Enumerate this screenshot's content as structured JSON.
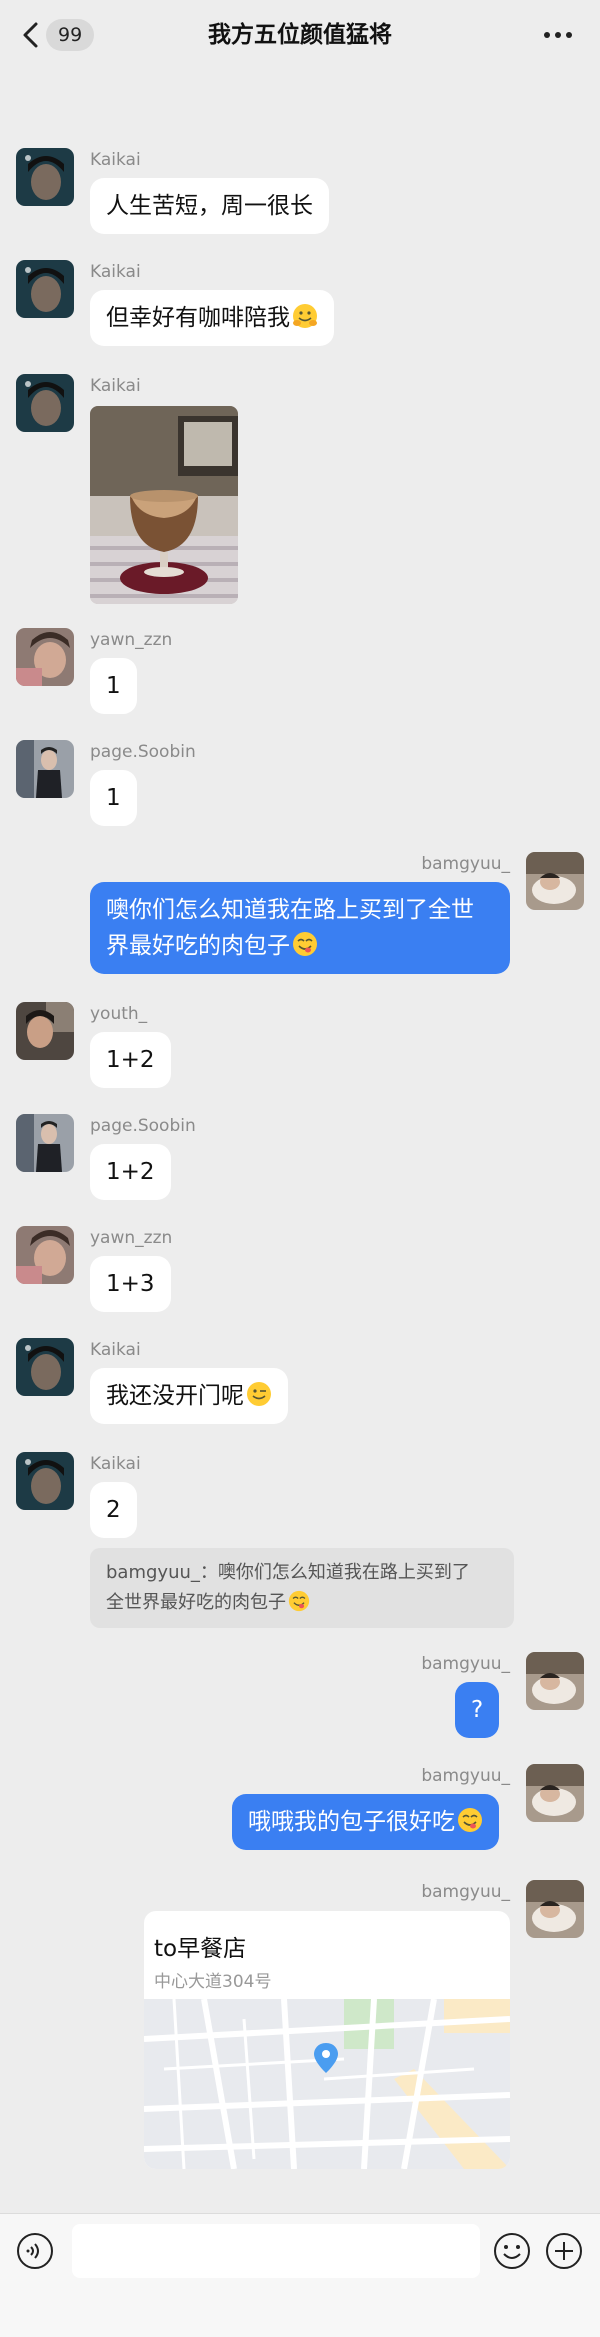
{
  "header": {
    "title": "我方五位颜值猛将",
    "unread_count": "99"
  },
  "users": {
    "kaikai": "Kaikai",
    "yawn": "yawn_zzn",
    "soobin": "page.Soobin",
    "me": "bamgyuu_",
    "youth": "youth_"
  },
  "messages": {
    "m1": "人生苦短，周一很长",
    "m2": "但幸好有咖啡陪我",
    "m4": "1",
    "m5": "1",
    "m6_line1": "噢你们怎么知道我在路上买到了全世",
    "m6_line2": "界最好吃的肉包子",
    "m7": "1+2",
    "m8": "1+2",
    "m9": "1+3",
    "m10": "我还没开门呢",
    "m11": "2",
    "m11_quote_line1": "bamgyuu_：噢你们怎么知道我在路上买到了",
    "m11_quote_line2": "全世界最好吃的肉包子",
    "m12": "?",
    "m13": "哦哦我的包子很好吃"
  },
  "location": {
    "name": "to早餐店",
    "address": "中心大道304号"
  },
  "colors": {
    "background": "#ededed",
    "my_bubble": "#3a7ff2",
    "other_bubble": "#ffffff"
  },
  "icons": {
    "back": "chevron-left-icon",
    "more": "more-dots-icon",
    "voice": "voice-icon",
    "emoji": "emoji-icon",
    "plus": "plus-circle-icon"
  }
}
